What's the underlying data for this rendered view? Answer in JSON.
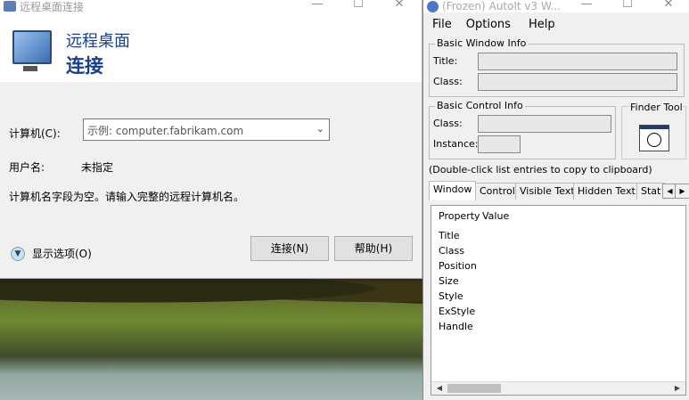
{
  "rdp": {
    "window_title": "远程桌面连接",
    "banner_line1": "远程桌面",
    "banner_line2": "连接",
    "computer_label": "计算机(C):",
    "computer_placeholder": "示例: computer.fabrikam.com",
    "username_label": "用户名:",
    "username_value": "未指定",
    "message": "计算机名字段为空。请输入完整的远程计算机名。",
    "show_options": "显示选项(O)",
    "connect_button": "连接(N)",
    "help_button": "帮助(H)"
  },
  "autoit": {
    "window_title": "(Frozen) AutoIt v3 W...",
    "menu": [
      "File",
      "Options",
      "Help"
    ],
    "basic_window_info": "Basic Window Info",
    "title_label": "Title:",
    "class_label": "Class:",
    "basic_control_info": "Basic Control Info",
    "control_class_label": "Class:",
    "instance_label": "Instance:",
    "finder_tool": "Finder Tool",
    "hint": "(Double-click list entries to copy to clipboard)",
    "tabs": [
      "Window",
      "Control",
      "Visible Text",
      "Hidden Text",
      "Stat"
    ],
    "columns": [
      "Property",
      "Value"
    ],
    "properties": [
      "Title",
      "Class",
      "Position",
      "Size",
      "Style",
      "ExStyle",
      "Handle"
    ]
  },
  "window_controls": {
    "minimize": "—",
    "maximize": "☐",
    "close": "✕"
  }
}
